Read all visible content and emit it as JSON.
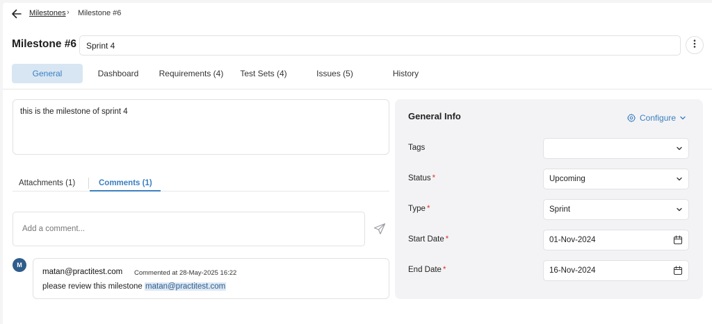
{
  "breadcrumb": {
    "parent": "Milestones",
    "separator": "›",
    "current": "Milestone #6"
  },
  "header": {
    "title": "Milestone #6",
    "name_value": "Sprint 4"
  },
  "tabs": [
    {
      "label": "General",
      "active": true
    },
    {
      "label": "Dashboard"
    },
    {
      "label": "Requirements (4)"
    },
    {
      "label": "Test Sets (4)"
    },
    {
      "label": "Issues (5)"
    },
    {
      "label": "History"
    }
  ],
  "description": "this is the milestone of sprint 4",
  "subtabs": [
    {
      "label": "Attachments (1)"
    },
    {
      "label": "Comments (1)",
      "active": true
    }
  ],
  "comment_input": {
    "placeholder": "Add a comment..."
  },
  "comments": [
    {
      "avatar": "M",
      "author": "matan@practitest.com",
      "meta": "Commented at 28-May-2025 16:22",
      "text": "please review this milestone",
      "mention": "matan@practitest.com"
    }
  ],
  "general_info": {
    "title": "General Info",
    "configure_label": "Configure",
    "required_marker": "*",
    "fields": [
      {
        "label": "Tags",
        "value": "",
        "required": false,
        "control": "select"
      },
      {
        "label": "Status",
        "value": "Upcoming",
        "required": true,
        "control": "select"
      },
      {
        "label": "Type",
        "value": "Sprint",
        "required": true,
        "control": "select"
      },
      {
        "label": "Start Date",
        "value": "01-Nov-2024",
        "required": true,
        "control": "date"
      },
      {
        "label": "End Date",
        "value": "16-Nov-2024",
        "required": true,
        "control": "date"
      }
    ]
  },
  "colors": {
    "accent": "#3a7fc0",
    "tab_active_bg": "#d8e6f3",
    "panel_bg": "#f3f3f5",
    "required": "#d9342b",
    "avatar_bg": "#2f5d8c"
  },
  "icons": [
    "back-arrow-icon",
    "more-vertical-icon",
    "send-icon",
    "gear-icon",
    "chevron-down-icon",
    "calendar-icon"
  ]
}
